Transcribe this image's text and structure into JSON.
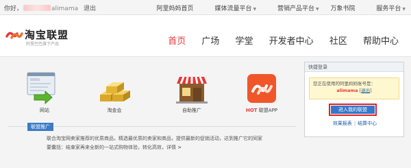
{
  "topbar": {
    "greeting": "你好，",
    "username": "alimama",
    "logout": "退出",
    "links": [
      "阿里妈妈首页",
      "媒体流量平台",
      "营销产品平台",
      "万象书院",
      "服务平台"
    ]
  },
  "brand": {
    "name": "淘宝联盟",
    "tagline": "阿里巴巴旗下产品"
  },
  "nav": {
    "items": [
      "首页",
      "广场",
      "学堂",
      "开发者中心",
      "社区",
      "帮助中心"
    ]
  },
  "features": [
    {
      "label": "网站",
      "icon": "website-icon"
    },
    {
      "label": "淘金会",
      "icon": "gold-bars-icon"
    },
    {
      "label": "自助推广",
      "icon": "shop-icon"
    },
    {
      "label_hot": "HOT",
      "label": "联盟APP",
      "icon": "union-app-icon"
    }
  ],
  "intro": {
    "title": "联盟推广",
    "line1": "联合淘宝网卖家推荐的优质商品，精选最优质的卖家和商品，提供最新的促销活动，达到推广它的同家",
    "line2": "要囊括：结束家再来全新的一站式购物体验，转化高效，详情",
    "more": ">"
  },
  "quick": {
    "title": "快捷登录",
    "notice_line1": "您正在使用的阿里妈妈账号是：",
    "account": "alimama",
    "exit": "退出",
    "enter_button": "进入我的联盟",
    "link1": "效果报表",
    "link2": "结算中心"
  },
  "colors": {
    "accent_red": "#e4393c",
    "button_blue": "#3877c7",
    "link_blue": "#1d5fa6"
  }
}
